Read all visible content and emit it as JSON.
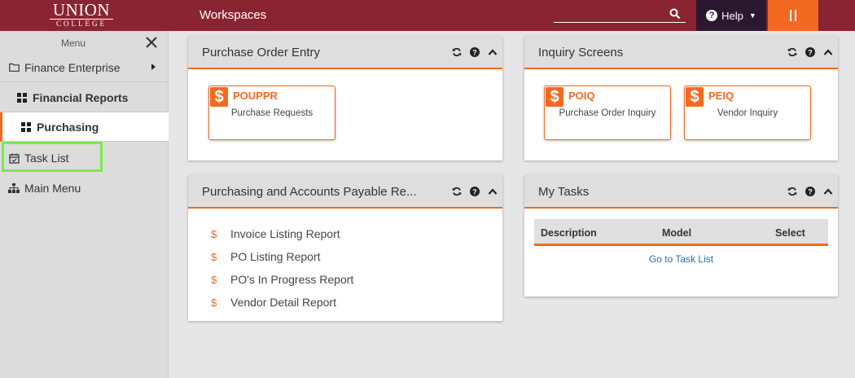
{
  "header": {
    "logo_line1": "UNION",
    "logo_line2": "COLLEGE",
    "title": "Workspaces",
    "search_placeholder": "",
    "help_label": "Help"
  },
  "sidebar": {
    "menu_label": "Menu",
    "items": [
      {
        "label": "Finance Enterprise",
        "icon": "folder-icon"
      },
      {
        "label": "Financial Reports",
        "icon": "grid-icon"
      },
      {
        "label": "Purchasing",
        "icon": "grid-icon",
        "active": true
      },
      {
        "label": "Task List",
        "icon": "calendar-check-icon",
        "highlighted": true
      },
      {
        "label": "Main Menu",
        "icon": "sitemap-icon"
      }
    ]
  },
  "cards": {
    "po_entry": {
      "title": "Purchase Order Entry",
      "tiles": [
        {
          "code": "POUPPR",
          "desc": "Purchase Requests"
        }
      ]
    },
    "inquiry": {
      "title": "Inquiry Screens",
      "tiles": [
        {
          "code": "POIQ",
          "desc": "Purchase Order Inquiry"
        },
        {
          "code": "PEIQ",
          "desc": "Vendor Inquiry"
        }
      ]
    },
    "reports": {
      "title": "Purchasing and Accounts Payable Re...",
      "items": [
        "Invoice Listing Report",
        "PO Listing Report",
        "PO's In Progress Report",
        "Vendor Detail Report"
      ]
    },
    "tasks": {
      "title": "My Tasks",
      "columns": [
        "Description",
        "Model",
        "Select"
      ],
      "link": "Go to Task List"
    }
  },
  "colors": {
    "brand": "#8a2432",
    "accent": "#f26a22",
    "help_bg": "#2b1830",
    "highlight": "#7bea4d"
  }
}
